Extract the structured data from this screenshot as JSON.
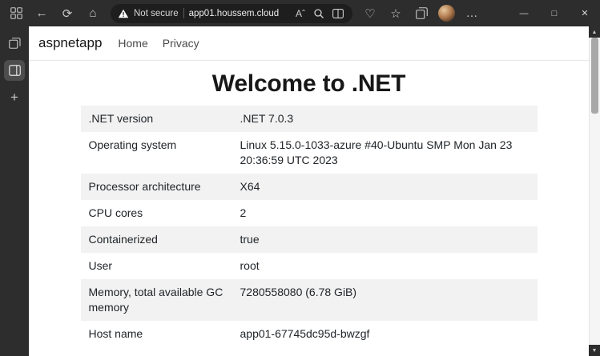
{
  "window": {
    "controls": {
      "minimize": "—",
      "maximize": "□",
      "close": "✕"
    }
  },
  "toolbar": {
    "security_label": "Not secure",
    "url": "app01.houssem.cloud",
    "icons": {
      "back": "←",
      "refresh": "⟳",
      "home": "⌂",
      "read_aloud": "Aˆ",
      "favorites": "☆",
      "essentials": "♡",
      "more": "…"
    }
  },
  "sidebar": {
    "icons": {
      "add": "+"
    }
  },
  "scrollbar": {
    "up": "▲",
    "down": "▼"
  },
  "page": {
    "brand": "aspnetapp",
    "nav": [
      {
        "label": "Home"
      },
      {
        "label": "Privacy"
      }
    ],
    "title": "Welcome to .NET",
    "info_table": {
      "rows": [
        {
          "label": ".NET version",
          "value": ".NET 7.0.3"
        },
        {
          "label": "Operating system",
          "value": "Linux 5.15.0-1033-azure #40-Ubuntu SMP Mon Jan 23 20:36:59 UTC 2023"
        },
        {
          "label": "Processor architecture",
          "value": "X64"
        },
        {
          "label": "CPU cores",
          "value": "2"
        },
        {
          "label": "Containerized",
          "value": "true"
        },
        {
          "label": "User",
          "value": "root"
        },
        {
          "label": "Memory, total available GC memory",
          "value": "7280558080 (6.78 GiB)"
        },
        {
          "label": "Host name",
          "value": "app01-67745dc95d-bwzgf"
        }
      ]
    }
  },
  "colors": {
    "chrome_bg": "#2d2d2d",
    "addressbar_bg": "#1e1e1e",
    "sidebar_selected": "#4d4d4d",
    "stripe": "#f2f2f2",
    "header_border": "#e7e7e7",
    "text": "#212529"
  }
}
